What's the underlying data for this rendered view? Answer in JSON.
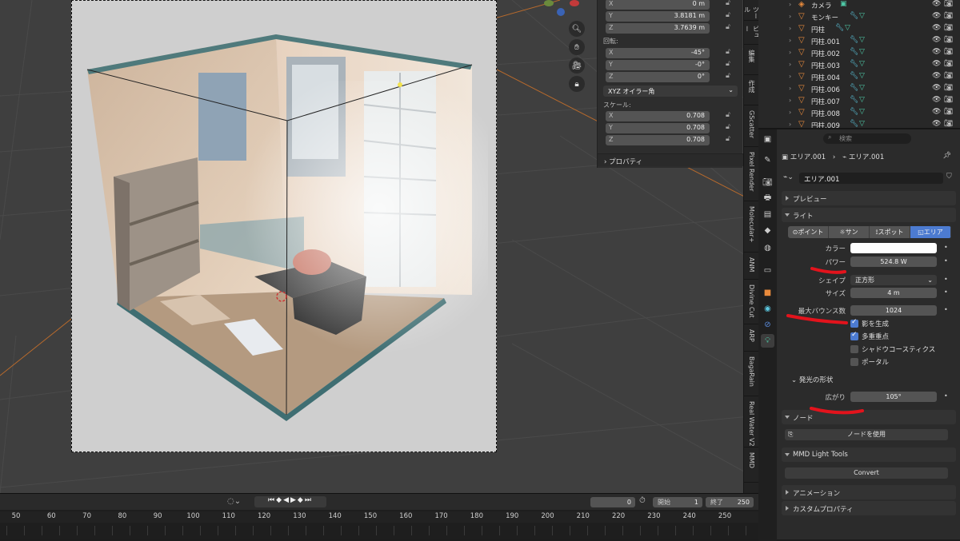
{
  "npanel": {
    "location": [
      {
        "axis": "X",
        "value": "0 m"
      },
      {
        "axis": "Y",
        "value": "3.8181 m"
      },
      {
        "axis": "Z",
        "value": "3.7639 m"
      }
    ],
    "rotation_label": "回転:",
    "rotation": [
      {
        "axis": "X",
        "value": "-45°"
      },
      {
        "axis": "Y",
        "value": "-0°"
      },
      {
        "axis": "Z",
        "value": "0°"
      }
    ],
    "rotation_mode": "XYZ オイラー角",
    "scale_label": "スケール:",
    "scale": [
      {
        "axis": "X",
        "value": "0.708"
      },
      {
        "axis": "Y",
        "value": "0.708"
      },
      {
        "axis": "Z",
        "value": "0.708"
      }
    ],
    "properties_label": "プロパティ"
  },
  "side_tabs": [
    "ツール",
    "ビュー",
    "編集",
    "作成",
    "GScatter",
    "Pixel Render",
    "Molecular+",
    "ANM",
    "Divine Cut",
    "ARP",
    "BagaRain",
    "Real Water V2",
    "MMD"
  ],
  "outliner": {
    "items": [
      {
        "name": "カメラ",
        "type": "camera"
      },
      {
        "name": "モンキー",
        "type": "mesh"
      },
      {
        "name": "円柱",
        "type": "mesh"
      },
      {
        "name": "円柱.001",
        "type": "mesh"
      },
      {
        "name": "円柱.002",
        "type": "mesh"
      },
      {
        "name": "円柱.003",
        "type": "mesh"
      },
      {
        "name": "円柱.004",
        "type": "mesh"
      },
      {
        "name": "円柱.006",
        "type": "mesh"
      },
      {
        "name": "円柱.007",
        "type": "mesh"
      },
      {
        "name": "円柱.008",
        "type": "mesh"
      },
      {
        "name": "円柱.009",
        "type": "mesh"
      }
    ]
  },
  "properties": {
    "search_placeholder": "検索",
    "breadcrumb_object": "エリア.001",
    "breadcrumb_data": "エリア.001",
    "data_name": "エリア.001",
    "sections": {
      "preview": "プレビュー",
      "light": "ライト",
      "emission_shape": "発光の形状",
      "nodes": "ノード",
      "mmd_tools": "MMD Light Tools",
      "animation": "アニメーション",
      "custom_props": "カスタムプロパティ"
    },
    "light_types": [
      "ポイント",
      "サン",
      "スポット",
      "エリア"
    ],
    "active_light_type": "エリア",
    "fields": {
      "color_label": "カラー",
      "color": "#ffffff",
      "power_label": "パワー",
      "power": "524.8 W",
      "shape_label": "シェイプ",
      "shape": "正方形",
      "size_label": "サイズ",
      "size": "4 m",
      "max_bounces_label": "最大バウンス数",
      "max_bounces": "1024",
      "spread_label": "広がり",
      "spread": "105°"
    },
    "checkboxes": [
      {
        "label": "影を生成",
        "checked": true
      },
      {
        "label": "多重重点",
        "checked": true
      },
      {
        "label": "シャドウコースティクス",
        "checked": false
      },
      {
        "label": "ポータル",
        "checked": false
      }
    ],
    "use_nodes_button": "ノードを使用",
    "convert_button": "Convert"
  },
  "timeline": {
    "current_frame": "0",
    "start_label": "開始",
    "start": "1",
    "end_label": "終了",
    "end": "250",
    "ruler": [
      "50",
      "60",
      "70",
      "80",
      "90",
      "100",
      "110",
      "120",
      "130",
      "140",
      "150",
      "160",
      "170",
      "180",
      "190",
      "200",
      "210",
      "220",
      "230",
      "240",
      "250"
    ]
  },
  "colors": {
    "accent": "#4c7bd1",
    "annotation": "#e3131c",
    "object_icon": "#e88a3c",
    "modifier_icon": "#5cc8e0",
    "data_icon": "#4ec9a6"
  }
}
